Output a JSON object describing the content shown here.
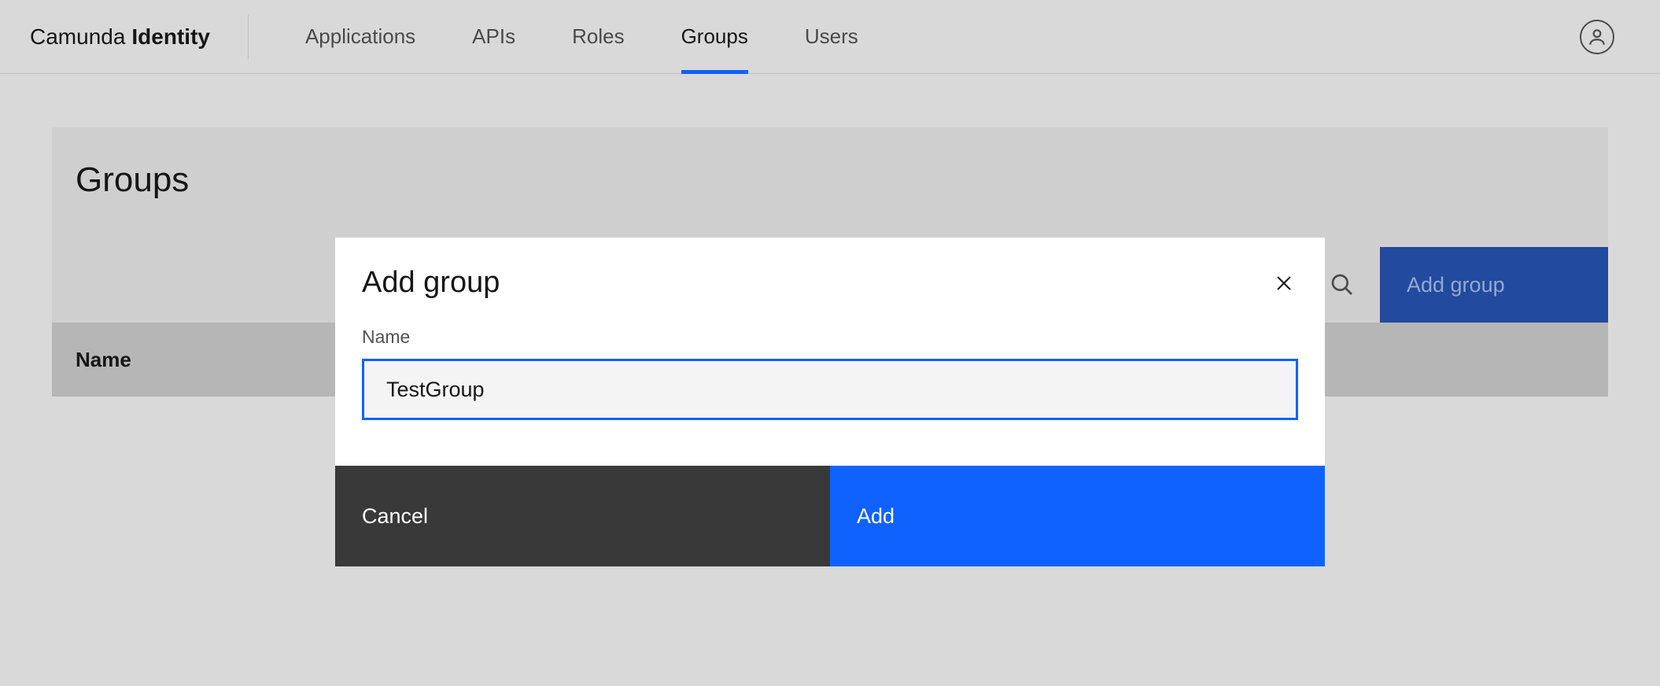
{
  "brand": {
    "name": "Camunda",
    "product": "Identity"
  },
  "nav": {
    "items": [
      {
        "label": "Applications",
        "active": false
      },
      {
        "label": "APIs",
        "active": false
      },
      {
        "label": "Roles",
        "active": false
      },
      {
        "label": "Groups",
        "active": true
      },
      {
        "label": "Users",
        "active": false
      }
    ]
  },
  "page": {
    "title": "Groups",
    "add_button_label": "Add group",
    "table": {
      "columns": [
        {
          "header": "Name"
        }
      ],
      "rows": []
    }
  },
  "modal": {
    "title": "Add group",
    "field_label": "Name",
    "field_value": "TestGroup",
    "cancel_label": "Cancel",
    "add_label": "Add"
  }
}
